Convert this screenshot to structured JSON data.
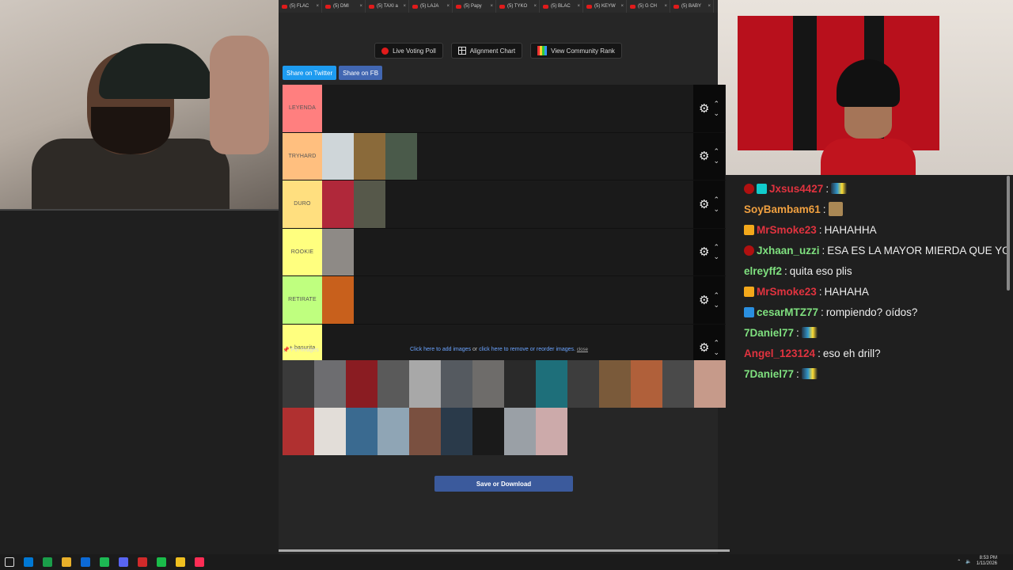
{
  "browser": {
    "tabs": [
      {
        "label": "(5) FLAC"
      },
      {
        "label": "(5) DMl"
      },
      {
        "label": "(5) TAXI a"
      },
      {
        "label": "(5) LAJA"
      },
      {
        "label": "(5) Papy"
      },
      {
        "label": "(5) TYKO"
      },
      {
        "label": "(5) BLAC"
      },
      {
        "label": "(5) KEYW"
      },
      {
        "label": "(5) G CH"
      },
      {
        "label": "(5) BABY"
      }
    ]
  },
  "toolbar": {
    "live_poll": "Live Voting Poll",
    "alignment": "Alignment Chart",
    "community": "View Community Rank"
  },
  "share": {
    "twitter": "Share on Twitter",
    "facebook": "Share on FB"
  },
  "tiers": [
    {
      "label": "LEYENDA",
      "color": "#ff7f7f",
      "thumbs": []
    },
    {
      "label": "TRYHARD",
      "color": "#ffbf7f",
      "thumbs": [
        "#cfd6d9",
        "#8a6a3a",
        "#4a5a4a"
      ]
    },
    {
      "label": "DURO",
      "color": "#ffdf7f",
      "thumbs": [
        "#b0283a",
        "#56584a"
      ]
    },
    {
      "label": "ROOKIE",
      "color": "#ffff7f",
      "thumbs": [
        "#8e8a86"
      ]
    },
    {
      "label": "RETIRATE",
      "color": "#bfff7f",
      "thumbs": [
        "#c8601c"
      ]
    },
    {
      "label": "+ basurita",
      "color": "#ffff7f",
      "thumbs": []
    }
  ],
  "pin": {
    "label": "Pin Images",
    "add": "Click here to add images",
    "or": "or",
    "remove": "click here to remove or reorder images.",
    "close": "close"
  },
  "pool_thumbs": [
    "#3a3a3a",
    "#6d6d70",
    "#8a1c22",
    "#5a5a5a",
    "#a8a8a8",
    "#555a60",
    "#6e6c6a",
    "#2a2a2a",
    "#1e6f7a",
    "#3d3d3d",
    "#7a5a3a",
    "#b0603a",
    "#4a4a4a",
    "#c69a8a",
    "#b03030",
    "#e2ddd8",
    "#3a6a90",
    "#8fa5b5",
    "#7a5040",
    "#2a3a4a",
    "#1a1a1a",
    "#9aa0a6",
    "#caa"
  ],
  "save_label": "Save or Download",
  "chat": [
    {
      "badges": [
        "b-red",
        "b-teal"
      ],
      "name": "Jxsus4427",
      "color": "#e0333f",
      "text": "",
      "emote": "flag"
    },
    {
      "badges": [],
      "name": "SoyBambam61",
      "color": "#f0a040",
      "text": "",
      "emote": "face"
    },
    {
      "badges": [
        "b-gold"
      ],
      "name": "MrSmoke23",
      "color": "#e0333f",
      "text": "HAHAHHA",
      "emote": ""
    },
    {
      "badges": [
        "b-red"
      ],
      "name": "Jxhaan_uzzi",
      "color": "#7fe07f",
      "text": "ESA ES LA MAYOR MIERDA QUE YO H",
      "emote": ""
    },
    {
      "badges": [],
      "name": "elreyff2",
      "color": "#7fe07f",
      "text": "quita eso plis",
      "emote": ""
    },
    {
      "badges": [
        "b-gold"
      ],
      "name": "MrSmoke23",
      "color": "#e0333f",
      "text": "HAHAHA",
      "emote": ""
    },
    {
      "badges": [
        "b-blue"
      ],
      "name": "cesarMTZ77",
      "color": "#7fe07f",
      "text": "rompiendo? oídos?",
      "emote": ""
    },
    {
      "badges": [],
      "name": "7Daniel77",
      "color": "#7fe07f",
      "text": "",
      "emote": "flag"
    },
    {
      "badges": [],
      "name": "Angel_123124",
      "color": "#e0333f",
      "text": "eso eh drill?",
      "emote": ""
    },
    {
      "badges": [],
      "name": "7Daniel77",
      "color": "#7fe07f",
      "text": "",
      "emote": "flag"
    }
  ],
  "chat_separator": ":",
  "taskbar": {
    "time": "8:53 PM",
    "date": "1/11/2026",
    "icons": [
      "#0078d4",
      "#1a9e4a",
      "#e8b02a",
      "#0c6ad6",
      "#1db954",
      "#5865f2",
      "#d02a2a",
      "#1abc4a",
      "#f0c020",
      "#ff2d55"
    ]
  }
}
